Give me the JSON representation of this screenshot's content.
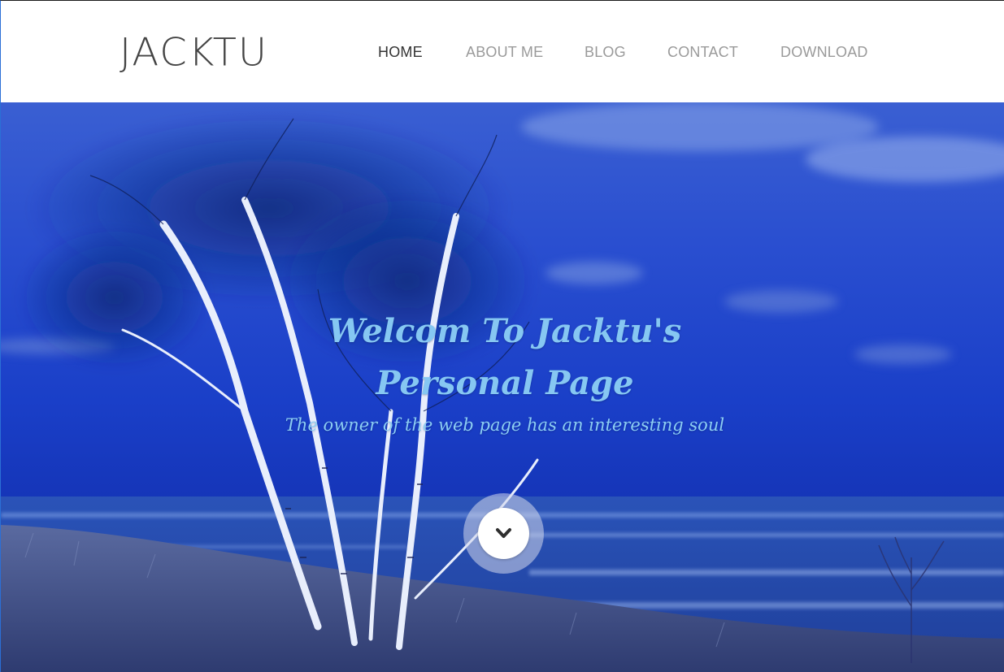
{
  "brand": {
    "logo_text": "JACKTU"
  },
  "nav": {
    "items": [
      {
        "label": "HOME",
        "active": true
      },
      {
        "label": "ABOUT ME",
        "active": false
      },
      {
        "label": "BLOG",
        "active": false
      },
      {
        "label": "CONTACT",
        "active": false
      },
      {
        "label": "DOWNLOAD",
        "active": false
      }
    ]
  },
  "hero": {
    "title_line1": "Welcom To Jacktu's",
    "title_line2": "Personal Page",
    "subtitle": "The owner of the web page has an interesting soul",
    "scroll_button_icon": "chevron-down-icon"
  },
  "colors": {
    "nav_active": "#333333",
    "nav_inactive": "#9a9a9a",
    "hero_text": "#86c7f2",
    "hero_sky": "#1a3fc4"
  }
}
